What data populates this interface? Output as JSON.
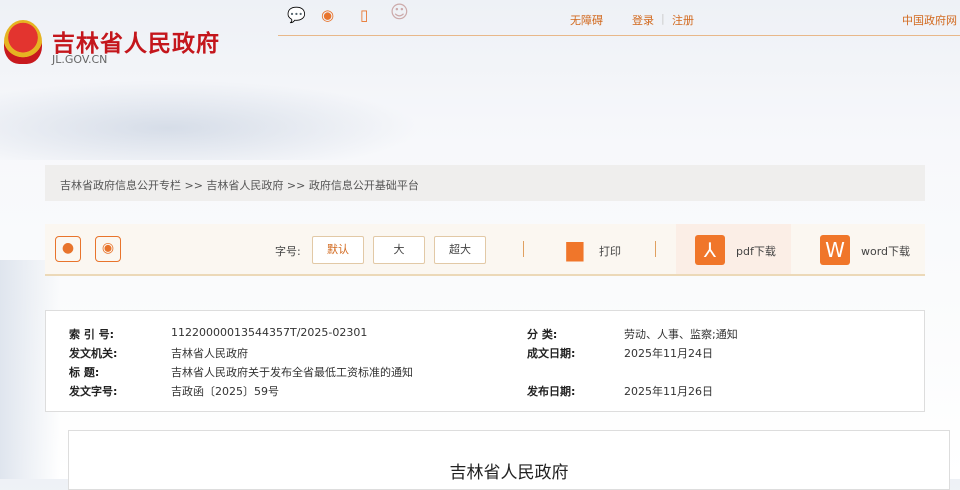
{
  "header": {
    "title": "吉林省人民政府",
    "domain": "JL.GOV.CN",
    "icons": [
      "wechat-icon",
      "weibo-icon",
      "mobile-icon",
      "mascot-icon"
    ],
    "links": {
      "accessibility": "无障碍",
      "login": "登录",
      "divider": "|",
      "register": "注册",
      "gov_portal": "中国政府网"
    }
  },
  "breadcrumb": {
    "text": "吉林省政府信息公开专栏 >> 吉林省人民政府 >> 政府信息公开基础平台"
  },
  "toolbar": {
    "font_size_label": "字号:",
    "font_sizes": [
      "默认",
      "大",
      "超大"
    ],
    "selected_font_size": "默认",
    "print": "打印",
    "pdf": "pdf下载",
    "word": "word下载",
    "word_icon": "W"
  },
  "meta": {
    "index_label": "索 引 号:",
    "index_value": "11220000013544357T/2025-02301",
    "category_label": "分 类:",
    "category_value": "劳动、人事、监察;通知",
    "issuer_label": "发文机关:",
    "issuer_value": "吉林省人民政府",
    "date_written_label": "成文日期:",
    "date_written_value": "2025年11月24日",
    "title_label": "标 题:",
    "title_value": "吉林省人民政府关于发布全省最低工资标准的通知",
    "doc_no_label": "发文字号:",
    "doc_no_value": "吉政函〔2025〕59号",
    "publish_label": "发布日期:",
    "publish_value": "2025年11月26日"
  },
  "document": {
    "heading": "吉林省人民政府"
  },
  "colors": {
    "brand_red": "#c4161c",
    "accent_orange": "#f0762a"
  }
}
